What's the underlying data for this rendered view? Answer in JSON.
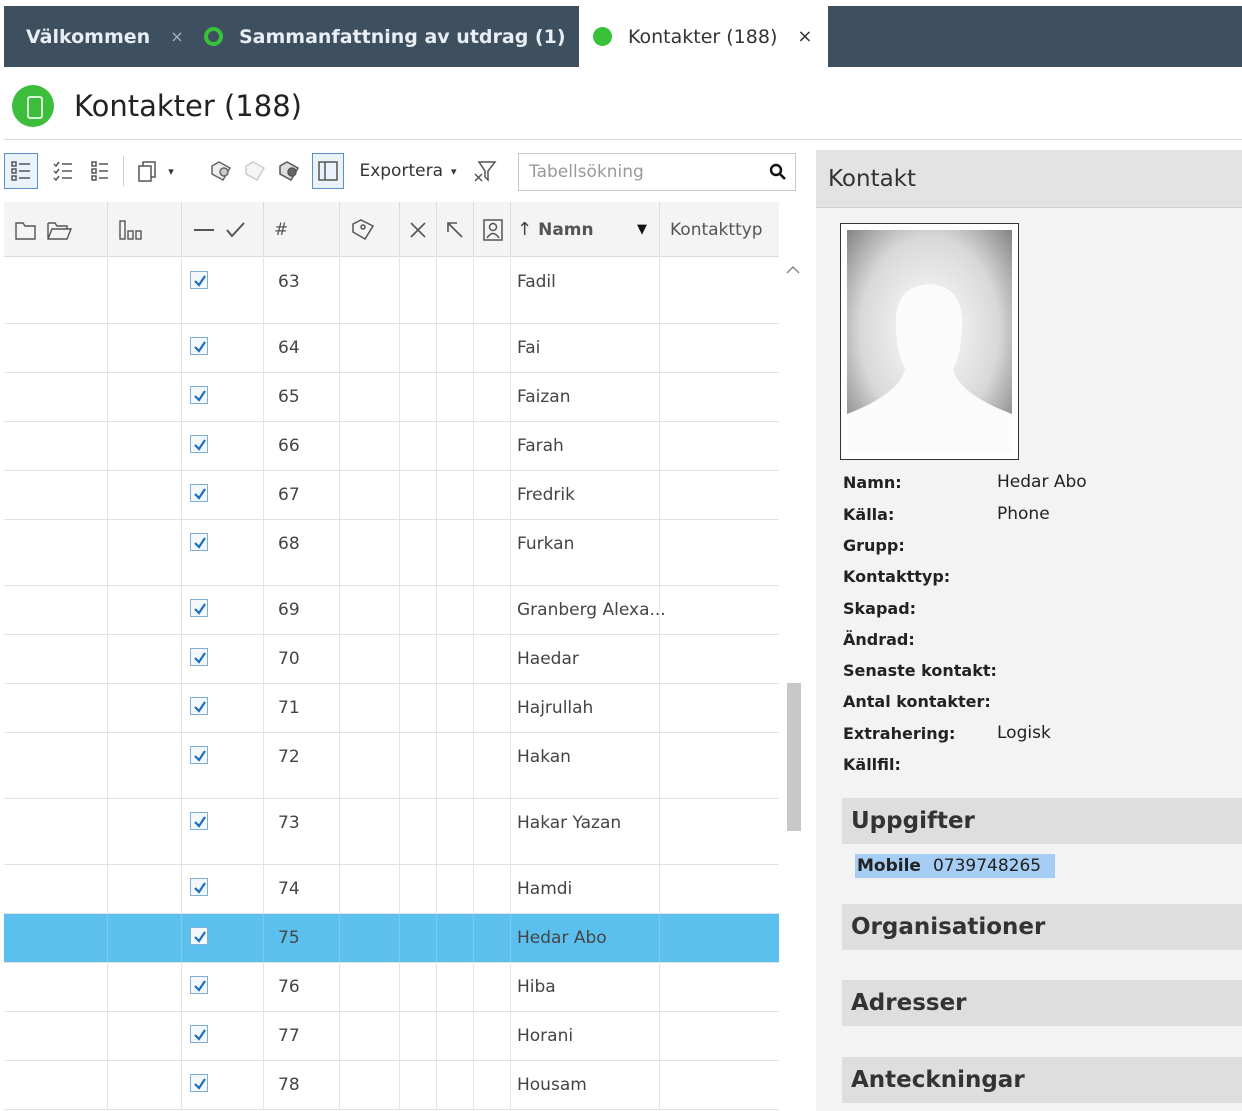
{
  "tabs": [
    {
      "label": "Välkommen",
      "close": "×"
    },
    {
      "label": "Sammanfattning av utdrag (1)",
      "close": "×"
    },
    {
      "label": "Kontakter (188)",
      "close": "×"
    }
  ],
  "page": {
    "title": "Kontakter (188)"
  },
  "toolbar": {
    "export_label": "Exportera",
    "search_placeholder": "Tabellsökning"
  },
  "grid": {
    "columns": {
      "number": "#",
      "name": "Namn",
      "contact_type": "Kontakttyp"
    },
    "rows": [
      {
        "num": "63",
        "name": "Fadil",
        "checked": true
      },
      {
        "num": "64",
        "name": "Fai",
        "checked": true
      },
      {
        "num": "65",
        "name": "Faizan",
        "checked": true
      },
      {
        "num": "66",
        "name": "Farah",
        "checked": true
      },
      {
        "num": "67",
        "name": "Fredrik",
        "checked": true
      },
      {
        "num": "68",
        "name": "Furkan",
        "checked": true
      },
      {
        "num": "69",
        "name": "Granberg Alexa...",
        "checked": true
      },
      {
        "num": "70",
        "name": "Haedar",
        "checked": true
      },
      {
        "num": "71",
        "name": "Hajrullah",
        "checked": true
      },
      {
        "num": "72",
        "name": "Hakan",
        "checked": true
      },
      {
        "num": "73",
        "name": "Hakar Yazan",
        "checked": true
      },
      {
        "num": "74",
        "name": "Hamdi",
        "checked": true
      },
      {
        "num": "75",
        "name": "Hedar Abo",
        "checked": true,
        "selected": true
      },
      {
        "num": "76",
        "name": "Hiba",
        "checked": true
      },
      {
        "num": "77",
        "name": "Horani",
        "checked": true
      },
      {
        "num": "78",
        "name": "Housam",
        "checked": true
      }
    ]
  },
  "contact": {
    "header": "Kontakt",
    "fields": [
      {
        "label": "Namn:",
        "value": "Hedar Abo"
      },
      {
        "label": "Källa:",
        "value": "Phone"
      },
      {
        "label": "Grupp:",
        "value": ""
      },
      {
        "label": "Kontakttyp:",
        "value": ""
      },
      {
        "label": "Skapad:",
        "value": ""
      },
      {
        "label": "Ändrad:",
        "value": ""
      },
      {
        "label": "Senaste kontakt:",
        "value": ""
      },
      {
        "label": "Antal kontakter:",
        "value": ""
      },
      {
        "label": "Extrahering:",
        "value": "Logisk"
      },
      {
        "label": "Källfil:",
        "value": ""
      }
    ],
    "sections": {
      "uppgifter": "Uppgifter",
      "organisationer": "Organisationer",
      "adresser": "Adresser",
      "anteckningar": "Anteckningar"
    },
    "phone": {
      "type": "Mobile",
      "number": "0739748265"
    }
  },
  "colors": {
    "tabbar": "#3e4f5f",
    "accent_green": "#37c23a",
    "selected_row": "#5bc0ee",
    "phone_highlight": "#a6cdf3"
  }
}
